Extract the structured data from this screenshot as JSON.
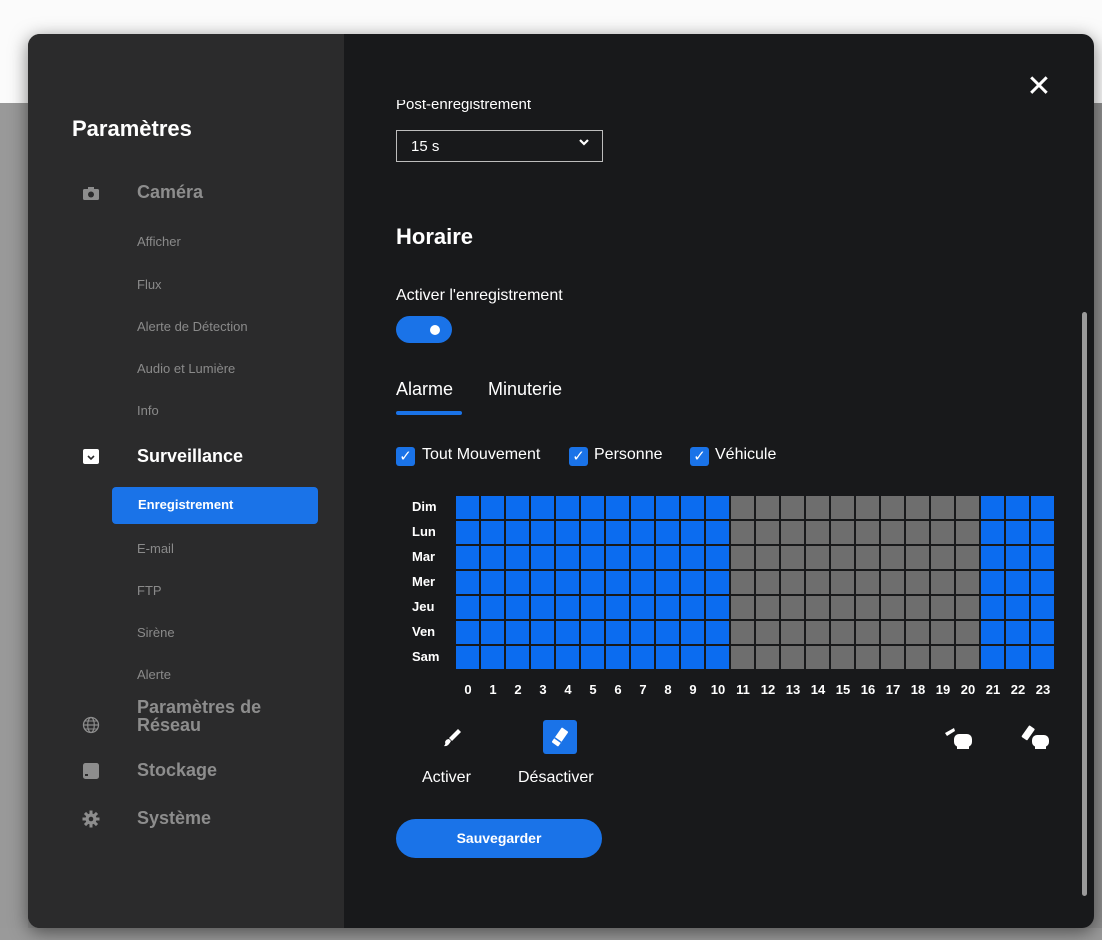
{
  "sidebar": {
    "title": "Paramètres",
    "sections": [
      {
        "label": "Caméra",
        "icon": "camera-icon",
        "items": [
          "Afficher",
          "Flux",
          "Alerte de Détection",
          "Audio et Lumière",
          "Info"
        ]
      },
      {
        "label": "Surveillance",
        "icon": "monitor-icon",
        "items": [
          "Enregistrement",
          "E-mail",
          "FTP",
          "Sirène",
          "Alerte"
        ],
        "active_item": "Enregistrement"
      },
      {
        "label": "Paramètres de Réseau",
        "icon": "globe-icon"
      },
      {
        "label": "Stockage",
        "icon": "storage-icon"
      },
      {
        "label": "Système",
        "icon": "gear-icon"
      }
    ]
  },
  "content": {
    "post_label": "Post-enregistrement",
    "post_value": "15 s",
    "schedule_title": "Horaire",
    "enable_label": "Activer l'enregistrement",
    "enable_on": true,
    "tabs": [
      "Alarme",
      "Minuterie"
    ],
    "active_tab": "Alarme",
    "checkboxes": [
      "Tout Mouvement",
      "Personne",
      "Véhicule"
    ],
    "days": [
      "Dim",
      "Lun",
      "Mar",
      "Mer",
      "Jeu",
      "Ven",
      "Sam"
    ],
    "hours": [
      "0",
      "1",
      "2",
      "3",
      "4",
      "5",
      "6",
      "7",
      "8",
      "9",
      "10",
      "11",
      "12",
      "13",
      "14",
      "15",
      "16",
      "17",
      "18",
      "19",
      "20",
      "21",
      "22",
      "23"
    ],
    "schedule_on_hours": [
      0,
      1,
      2,
      3,
      4,
      5,
      6,
      7,
      8,
      9,
      10,
      21,
      22,
      23
    ],
    "tool_activate": "Activer",
    "tool_deactivate": "Désactiver",
    "save_label": "Sauvegarder"
  },
  "colors": {
    "accent": "#1a73e8",
    "cell_on": "#0b6cf0",
    "cell_off": "#6e6e6e",
    "sidebar_bg": "#2b2b2c",
    "content_bg": "#18191b"
  }
}
